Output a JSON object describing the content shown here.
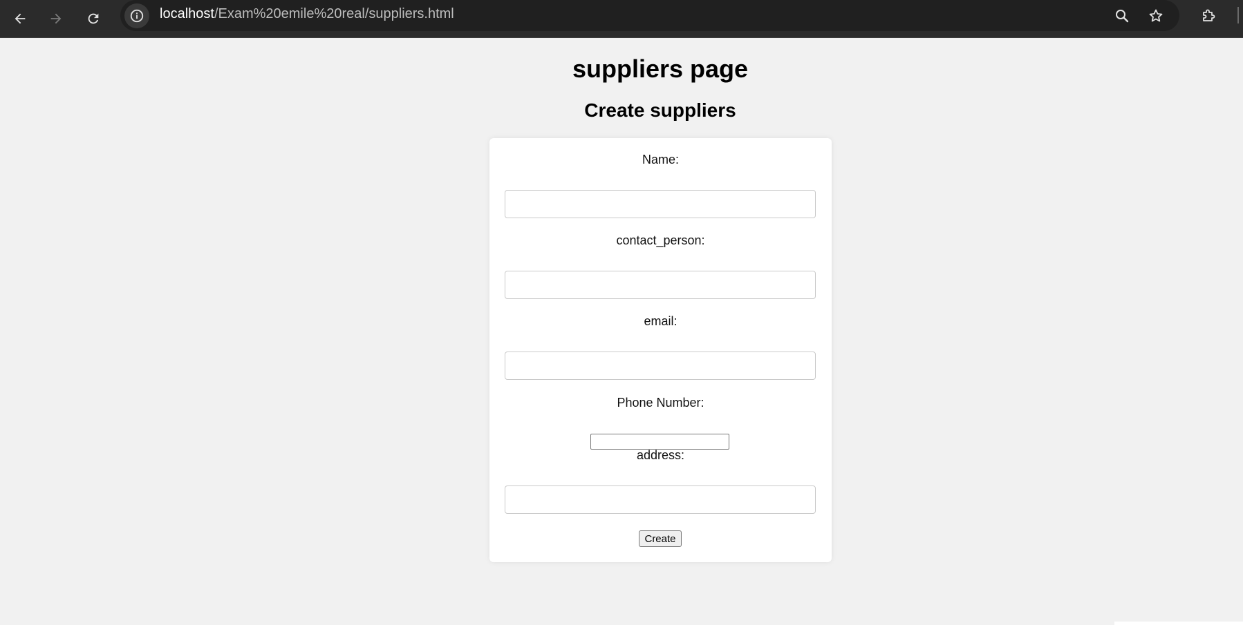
{
  "browser": {
    "url_host": "localhost",
    "url_path": "/Exam%20emile%20real/suppliers.html"
  },
  "page": {
    "title": "suppliers page",
    "subtitle": "Create suppliers"
  },
  "form": {
    "name_label": "Name:",
    "contact_label": "contact_person:",
    "email_label": "email:",
    "phone_label": "Phone Number:",
    "address_label": "address:",
    "name_value": "",
    "contact_value": "",
    "email_value": "",
    "phone_value": "",
    "address_value": "",
    "submit_label": "Create"
  }
}
